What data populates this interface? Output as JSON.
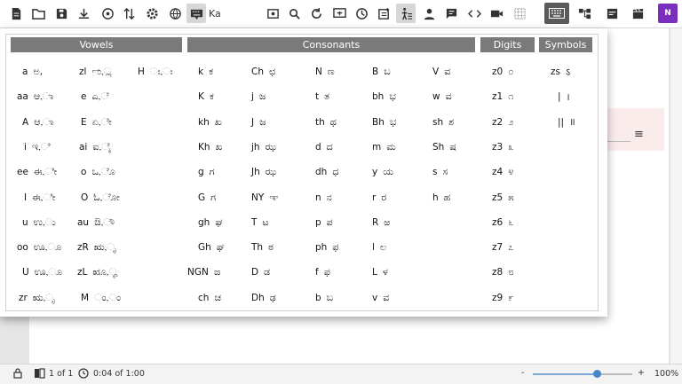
{
  "toolbar": {
    "language_label": "Ka",
    "brand_label": "N",
    "icons": [
      "document-icon",
      "folder-icon",
      "save-icon",
      "download-icon",
      "audio-icon",
      "sort-icon",
      "settings-icon",
      "globe-icon",
      "keyboard-language-icon",
      "image-icon",
      "search-icon",
      "refresh-icon",
      "present-icon",
      "check-icon",
      "note-icon",
      "accessibility-icon",
      "person-icon",
      "chat-icon",
      "code-icon",
      "video-icon",
      "grid-icon",
      "keyboard-icon",
      "layout-icon",
      "edit-icon",
      "clapper-icon"
    ]
  },
  "keyboard": {
    "headers": {
      "vowels": "Vowels",
      "consonants": "Consonants",
      "digits": "Digits",
      "symbols": "Symbols"
    },
    "vowels": [
      {
        "k": "a",
        "g": "ಅ,"
      },
      {
        "k": "zl",
        "g": "ಌ,ೢ"
      },
      {
        "k": "H",
        "g": "ಃ,ಃ"
      },
      {
        "k": "aa",
        "g": "ಆ,ಾ"
      },
      {
        "k": "e",
        "g": "ಎ,ೆ"
      },
      {
        "k": "A",
        "g": "ಆ,ಾ"
      },
      {
        "k": "E",
        "g": "ಏ,ೇ"
      },
      {
        "k": "i",
        "g": "ಇ,ಿ"
      },
      {
        "k": "ai",
        "g": "ಐ,ೈ"
      },
      {
        "k": "ee",
        "g": "ಈ,ೀ"
      },
      {
        "k": "o",
        "g": "ಒ,ೊ"
      },
      {
        "k": "I",
        "g": "ಈ,ೀ"
      },
      {
        "k": "O",
        "g": "ಓ,ೋ"
      },
      {
        "k": "u",
        "g": "ಉ,ು"
      },
      {
        "k": "au",
        "g": "ಔ,ೌ"
      },
      {
        "k": "oo",
        "g": "ಊ,ೂ"
      },
      {
        "k": "zR",
        "g": "ಋ,ೃ"
      },
      {
        "k": "U",
        "g": "ಊ,ೂ"
      },
      {
        "k": "zL",
        "g": "ೠ,ೄ"
      },
      {
        "k": "zr",
        "g": "ಋ,ೃ"
      },
      {
        "k": "M",
        "g": "ಂ,ಂ"
      }
    ],
    "consonants": [
      [
        {
          "k": "k",
          "g": "ಕ"
        },
        {
          "k": "Ch",
          "g": "ಛ"
        },
        {
          "k": "N",
          "g": "ಣ"
        },
        {
          "k": "B",
          "g": "ಬ"
        },
        {
          "k": "V",
          "g": "ವ"
        }
      ],
      [
        {
          "k": "K",
          "g": "ಕ"
        },
        {
          "k": "j",
          "g": "ಜ"
        },
        {
          "k": "t",
          "g": "ತ"
        },
        {
          "k": "bh",
          "g": "ಭ"
        },
        {
          "k": "w",
          "g": "ವ"
        }
      ],
      [
        {
          "k": "kh",
          "g": "ಖ"
        },
        {
          "k": "J",
          "g": "ಜ"
        },
        {
          "k": "th",
          "g": "ಥ"
        },
        {
          "k": "Bh",
          "g": "ಭ"
        },
        {
          "k": "sh",
          "g": "ಶ"
        }
      ],
      [
        {
          "k": "Kh",
          "g": "ಖ"
        },
        {
          "k": "jh",
          "g": "ಝ"
        },
        {
          "k": "d",
          "g": "ದ"
        },
        {
          "k": "m",
          "g": "ಮ"
        },
        {
          "k": "Sh",
          "g": "ಷ"
        }
      ],
      [
        {
          "k": "g",
          "g": "ಗ"
        },
        {
          "k": "Jh",
          "g": "ಝ"
        },
        {
          "k": "dh",
          "g": "ಧ"
        },
        {
          "k": "y",
          "g": "ಯ"
        },
        {
          "k": "s",
          "g": "ಸ"
        }
      ],
      [
        {
          "k": "G",
          "g": "ಗ"
        },
        {
          "k": "NY",
          "g": "ಞ"
        },
        {
          "k": "n",
          "g": "ನ"
        },
        {
          "k": "r",
          "g": "ರ"
        },
        {
          "k": "h",
          "g": "ಹ"
        }
      ],
      [
        {
          "k": "gh",
          "g": "ಘ"
        },
        {
          "k": "T",
          "g": "ಟ"
        },
        {
          "k": "p",
          "g": "ಪ"
        },
        {
          "k": "R",
          "g": "ಱ"
        }
      ],
      [
        {
          "k": "Gh",
          "g": "ಘ"
        },
        {
          "k": "Th",
          "g": "ಠ"
        },
        {
          "k": "ph",
          "g": "ಫ"
        },
        {
          "k": "l",
          "g": "ಲ"
        }
      ],
      [
        {
          "k": "NGN",
          "g": "ಙ"
        },
        {
          "k": "D",
          "g": "ಡ"
        },
        {
          "k": "f",
          "g": "ಫ"
        },
        {
          "k": "L",
          "g": "ಳ"
        }
      ],
      [
        {
          "k": "ch",
          "g": "ಚ"
        },
        {
          "k": "Dh",
          "g": "ಢ"
        },
        {
          "k": "b",
          "g": "ಬ"
        },
        {
          "k": "v",
          "g": "ವ"
        }
      ]
    ],
    "digits": [
      {
        "k": "z0",
        "g": "೦"
      },
      {
        "k": "z1",
        "g": "೧"
      },
      {
        "k": "z2",
        "g": "೨"
      },
      {
        "k": "z3",
        "g": "೩"
      },
      {
        "k": "z4",
        "g": "೪"
      },
      {
        "k": "z5",
        "g": "೫"
      },
      {
        "k": "z6",
        "g": "೬"
      },
      {
        "k": "z7",
        "g": "೭"
      },
      {
        "k": "z8",
        "g": "೮"
      },
      {
        "k": "z9",
        "g": "೯"
      }
    ],
    "symbols": [
      {
        "k": "zs",
        "g": "ऽ"
      },
      {
        "k": "|",
        "g": "।"
      },
      {
        "k": "||",
        "g": "॥"
      }
    ]
  },
  "status": {
    "page": "1 of 1",
    "time": "0:04 of 1:00",
    "zoom_minus": "-",
    "zoom_plus": "+",
    "zoom": "100%",
    "zoom_level": 0.65
  }
}
